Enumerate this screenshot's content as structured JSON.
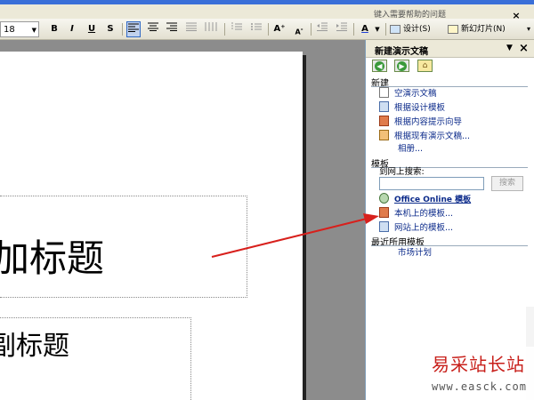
{
  "menu": {
    "help_placeholder": "键入需要帮助的问题",
    "close": "×"
  },
  "toolbar": {
    "font_size": "18",
    "bold": "B",
    "italic": "I",
    "underline": "U",
    "shadow": "S",
    "font_grow": "A⁺",
    "font_color": "A",
    "design_label": "设计(S)",
    "new_slide_label": "新幻灯片(N)"
  },
  "slide": {
    "title_text": "加标题",
    "subtitle_text": "副标题"
  },
  "task_pane": {
    "title": "新建演示文稿",
    "close": "×",
    "new_section": "新建",
    "new_items": [
      "空演示文稿",
      "根据设计模板",
      "根据内容提示向导",
      "根据现有演示文稿...",
      "相册..."
    ],
    "template_section": "模板",
    "search_label": "到网上搜索:",
    "search_button": "搜索",
    "template_items": [
      "Office Online 模板",
      "本机上的模板...",
      "网站上的模板..."
    ],
    "recent_section": "最近所用模板",
    "recent_items": [
      "市场计划"
    ]
  },
  "watermark": {
    "name": "易采站长站",
    "url": "www.easck.com"
  },
  "colors": {
    "arrow": "#d8201c",
    "pane_link": "#0b2a8a"
  }
}
